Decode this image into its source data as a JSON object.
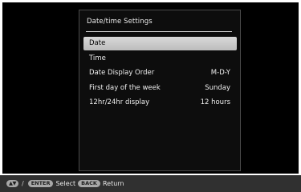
{
  "panel": {
    "title": "Date/time Settings"
  },
  "menu": {
    "items": [
      {
        "label": "Date",
        "value": "",
        "selected": true
      },
      {
        "label": "Time",
        "value": "",
        "selected": false
      },
      {
        "label": "Date Display Order",
        "value": "M-D-Y",
        "selected": false
      },
      {
        "label": "First day of the week",
        "value": "Sunday",
        "selected": false
      },
      {
        "label": "12hr/24hr display",
        "value": "12 hours",
        "selected": false
      }
    ]
  },
  "statusbar": {
    "arrows_key": "▲▼",
    "separator": "/",
    "enter_key": "ENTER",
    "select_label": "Select",
    "back_key": "BACK",
    "return_label": "Return"
  }
}
